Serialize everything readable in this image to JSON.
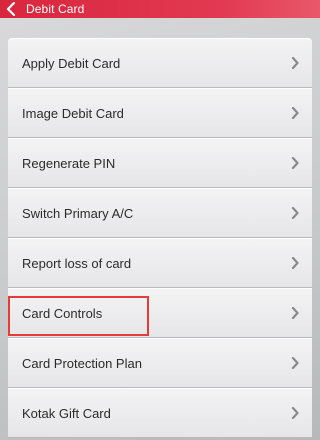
{
  "header": {
    "title": "Debit Card",
    "back_icon": "chevron-left-icon"
  },
  "menu": {
    "items": [
      {
        "label": "Apply Debit Card",
        "icon": "chevron-right-icon"
      },
      {
        "label": "Image Debit Card",
        "icon": "chevron-right-icon"
      },
      {
        "label": "Regenerate PIN",
        "icon": "chevron-right-icon"
      },
      {
        "label": "Switch Primary A/C",
        "icon": "chevron-right-icon"
      },
      {
        "label": "Report loss of card",
        "icon": "chevron-right-icon"
      },
      {
        "label": "Card Controls",
        "icon": "chevron-right-icon",
        "highlighted": true
      },
      {
        "label": "Card Protection Plan",
        "icon": "chevron-right-icon"
      },
      {
        "label": "Kotak Gift Card",
        "icon": "chevron-right-icon"
      }
    ]
  },
  "colors": {
    "header_background": "#d8263d",
    "highlight_border": "#e63b3b",
    "item_text": "#2b2b2b",
    "chevron": "#8a8a8d"
  }
}
